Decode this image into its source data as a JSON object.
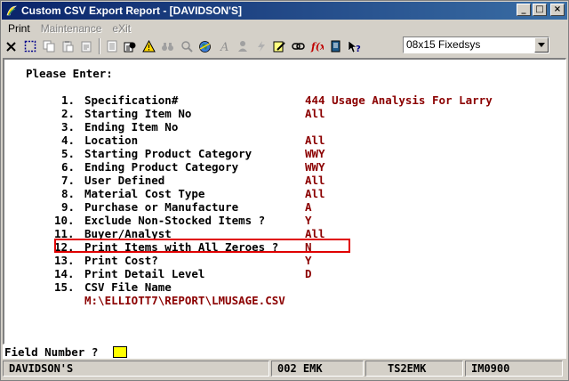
{
  "window": {
    "title": "Custom CSV Export Report - [DAVIDSON'S]",
    "minimize": "_",
    "maximize": "□",
    "close": "×"
  },
  "menu": [
    "Print",
    "Maintenance",
    "eXit"
  ],
  "toolbar": {
    "icons": [
      "close-x-icon",
      "select-icon",
      "copy-icon",
      "paste-icon",
      "clipboard-icon",
      "notes-icon",
      "report-icon",
      "alert-icon",
      "binoculars-icon",
      "magnifier-icon",
      "globe-icon",
      "script-a-icon",
      "person-icon",
      "lightning-icon",
      "edit-icon",
      "link-icon",
      "function-icon",
      "book-icon",
      "help-pointer-icon"
    ],
    "font_select": "08x15 Fixedsys"
  },
  "screen": {
    "heading": "Please Enter:",
    "fields": [
      {
        "num": "1.",
        "label": "Specification#",
        "value": "444 Usage Analysis For Larry"
      },
      {
        "num": "2.",
        "label": "Starting Item No",
        "value": "All"
      },
      {
        "num": "3.",
        "label": "Ending Item No",
        "value": ""
      },
      {
        "num": "4.",
        "label": "Location",
        "value": "All"
      },
      {
        "num": "5.",
        "label": "Starting Product Category",
        "value": "WWY"
      },
      {
        "num": "6.",
        "label": "Ending Product Category",
        "value": "WWY"
      },
      {
        "num": "7.",
        "label": "User Defined",
        "value": "All"
      },
      {
        "num": "8.",
        "label": "Material Cost Type",
        "value": "All"
      },
      {
        "num": "9.",
        "label": "Purchase or Manufacture",
        "value": "A"
      },
      {
        "num": "10.",
        "label": "Exclude Non-Stocked Items ?",
        "value": "Y"
      },
      {
        "num": "11.",
        "label": "Buyer/Analyst",
        "value": "All"
      },
      {
        "num": "12.",
        "label": "Print Items with All Zeroes ?",
        "value": "N"
      },
      {
        "num": "13.",
        "label": "Print Cost?",
        "value": "Y"
      },
      {
        "num": "14.",
        "label": "Print Detail Level",
        "value": "D"
      },
      {
        "num": "15.",
        "label": "CSV File Name",
        "value": ""
      }
    ],
    "csv_path": "M:\\ELLIOTT7\\REPORT\\LMUSAGE.CSV",
    "value_color": "#8b0000",
    "highlight_color": "#e00000"
  },
  "prompt": {
    "label": "Field Number ?"
  },
  "status": {
    "company": "DAVIDSON'S",
    "code": "002 EMK",
    "terminal": "TS2EMK",
    "program": "IM0900"
  }
}
